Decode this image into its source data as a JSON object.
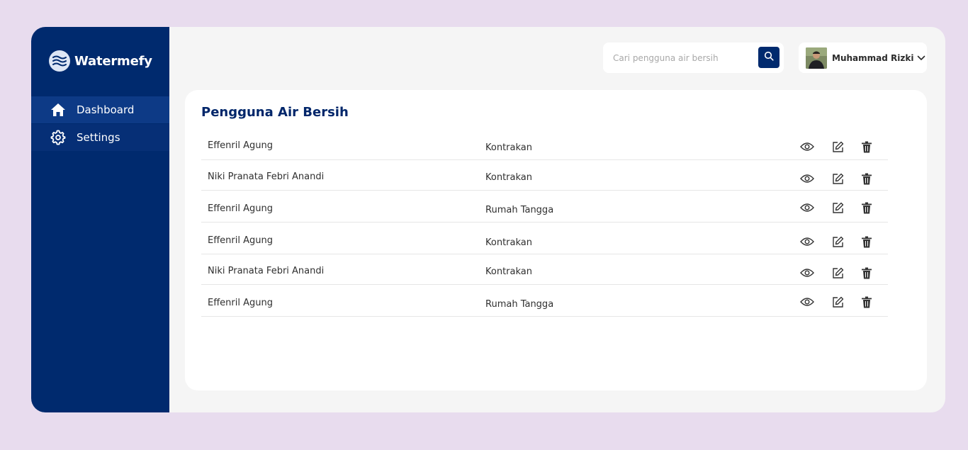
{
  "app": {
    "name": "Watermefy"
  },
  "sidebar": {
    "items": [
      {
        "label": "Dashboard",
        "icon": "home-icon",
        "active": true
      },
      {
        "label": "Settings",
        "icon": "gear-icon",
        "active": false
      }
    ]
  },
  "header": {
    "search": {
      "placeholder": "Cari pengguna air bersih",
      "value": ""
    },
    "user": {
      "name": "Muhammad Rizki"
    }
  },
  "main": {
    "title": "Pengguna Air Bersih",
    "rows": [
      {
        "name": "Effenril Agung",
        "type": "Kontrakan"
      },
      {
        "name": "Niki Pranata Febri Anandi",
        "type": "Kontrakan"
      },
      {
        "name": "Effenril Agung",
        "type": "Rumah Tangga"
      },
      {
        "name": "Effenril Agung",
        "type": "Kontrakan"
      },
      {
        "name": "Niki Pranata Febri Anandi",
        "type": "Kontrakan"
      },
      {
        "name": "Effenril Agung",
        "type": "Rumah Tangga"
      }
    ],
    "row_actions": [
      "eye-icon",
      "edit-icon",
      "trash-icon"
    ]
  },
  "colors": {
    "background": "#e8dcee",
    "sidebar": "#002a6e",
    "sidebar_active": "#0d3a86",
    "accent": "#002a6e",
    "title": "#00266a"
  }
}
